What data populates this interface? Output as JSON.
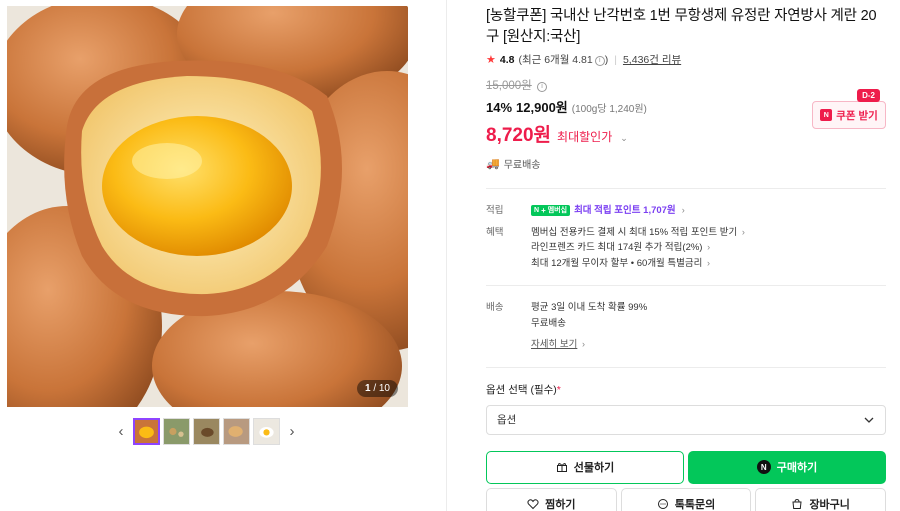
{
  "product": {
    "title": "[농할쿠폰] 국내산 난각번호 1번 무항생제 유정란 자연방사 계란 20구 [원산지:국산]",
    "rating": "4.8",
    "rating_detail": "(최근 6개월 4.81",
    "rating_detail_end": ")",
    "review_count": "5,436건 리뷰"
  },
  "price": {
    "original": "15,000원",
    "discount_rate": "14%",
    "sale_price": "12,900원",
    "unit_price": "(100g당 1,240원)",
    "best_price": "8,720원",
    "best_label": "최대할인가",
    "shipping": "무료배송"
  },
  "coupon": {
    "badge": "D-2",
    "label": "쿠폰 받기",
    "n": "N"
  },
  "benefits": {
    "point_label": "적립",
    "npay_text": "N",
    "npay_sub": "멤버십",
    "point_text": "최대 적립 포인트 1,707원",
    "benefit_label": "혜택",
    "benefit_lines": [
      "멤버십 전용카드 결제 시 최대 15% 적립 포인트 받기",
      "라인프렌즈 카드 최대 174원 추가 적립(2%)",
      "최대 12개월 무이자 할부 • 60개월 특별금리"
    ]
  },
  "delivery": {
    "label": "배송",
    "line1": "평균 3일 이내 도착 확률 99%",
    "line2": "무료배송",
    "more": "자세히 보기"
  },
  "option": {
    "label": "옵션 선택 (필수)",
    "required_mark": "*",
    "placeholder": "옵션"
  },
  "buttons": {
    "gift": "선물하기",
    "buy": "구매하기",
    "buy_n": "N",
    "wish": "찜하기",
    "talk": "톡톡문의",
    "cart": "장바구니"
  },
  "gallery": {
    "current": "1",
    "total": "/ 10",
    "prev": "‹",
    "next": "›"
  },
  "colors": {
    "accent_green": "#03c75a",
    "sale_red": "#ee1c4b",
    "point_purple": "#7b3ff2"
  }
}
